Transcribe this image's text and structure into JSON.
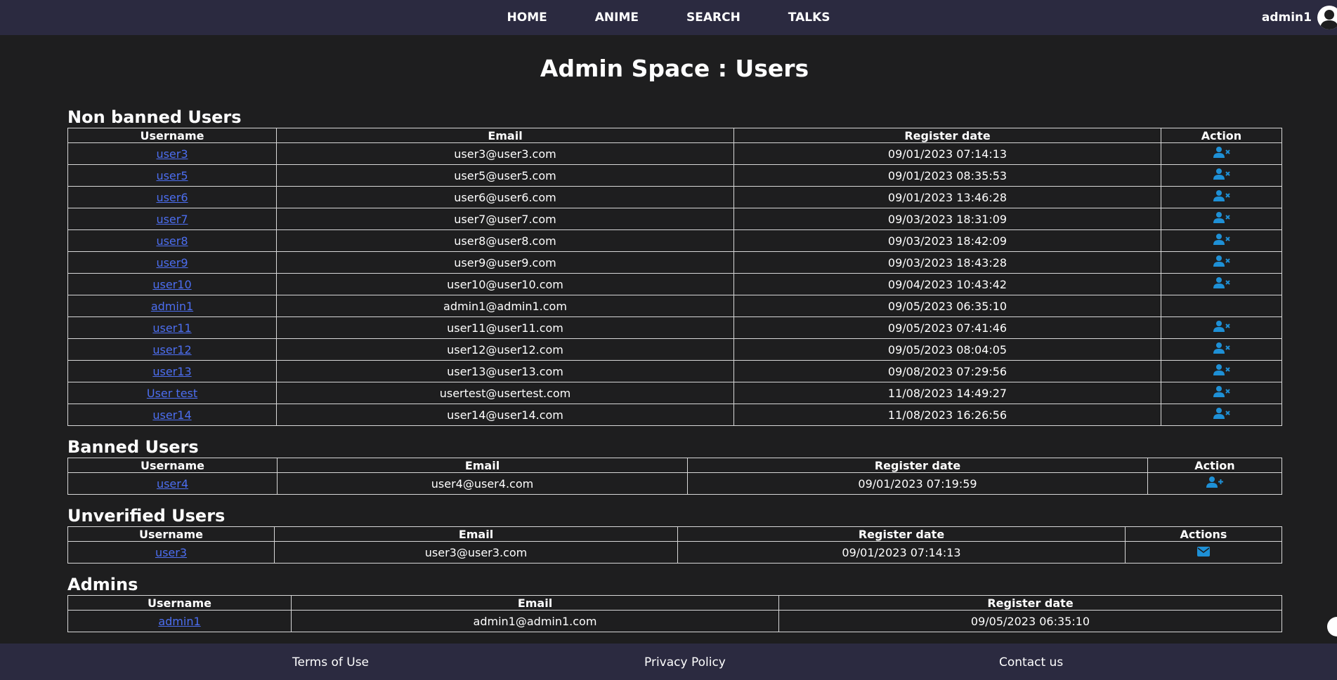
{
  "nav": {
    "links": [
      "HOME",
      "ANIME",
      "SEARCH",
      "TALKS"
    ],
    "username": "admin1",
    "avatar_icon": "user-avatar-icon"
  },
  "page_title": "Admin Space : Users",
  "non_banned": {
    "title": "Non banned Users",
    "headers": [
      "Username",
      "Email",
      "Register date",
      "Action"
    ],
    "rows": [
      {
        "username": "user3",
        "email": "user3@user3.com",
        "date": "09/01/2023 07:14:13",
        "action": "ban-user-icon"
      },
      {
        "username": "user5",
        "email": "user5@user5.com",
        "date": "09/01/2023 08:35:53",
        "action": "ban-user-icon"
      },
      {
        "username": "user6",
        "email": "user6@user6.com",
        "date": "09/01/2023 13:46:28",
        "action": "ban-user-icon"
      },
      {
        "username": "user7",
        "email": "user7@user7.com",
        "date": "09/03/2023 18:31:09",
        "action": "ban-user-icon"
      },
      {
        "username": "user8",
        "email": "user8@user8.com",
        "date": "09/03/2023 18:42:09",
        "action": "ban-user-icon"
      },
      {
        "username": "user9",
        "email": "user9@user9.com",
        "date": "09/03/2023 18:43:28",
        "action": "ban-user-icon"
      },
      {
        "username": "user10",
        "email": "user10@user10.com",
        "date": "09/04/2023 10:43:42",
        "action": "ban-user-icon"
      },
      {
        "username": "admin1",
        "email": "admin1@admin1.com",
        "date": "09/05/2023 06:35:10",
        "action": ""
      },
      {
        "username": "user11",
        "email": "user11@user11.com",
        "date": "09/05/2023 07:41:46",
        "action": "ban-user-icon"
      },
      {
        "username": "user12",
        "email": "user12@user12.com",
        "date": "09/05/2023 08:04:05",
        "action": "ban-user-icon"
      },
      {
        "username": "user13",
        "email": "user13@user13.com",
        "date": "09/08/2023 07:29:56",
        "action": "ban-user-icon"
      },
      {
        "username": "User test",
        "email": "usertest@usertest.com",
        "date": "11/08/2023 14:49:27",
        "action": "ban-user-icon"
      },
      {
        "username": "user14",
        "email": "user14@user14.com",
        "date": "11/08/2023 16:26:56",
        "action": "ban-user-icon"
      }
    ]
  },
  "banned": {
    "title": "Banned Users",
    "headers": [
      "Username",
      "Email",
      "Register date",
      "Action"
    ],
    "rows": [
      {
        "username": "user4",
        "email": "user4@user4.com",
        "date": "09/01/2023 07:19:59",
        "action": "unban-user-icon"
      }
    ]
  },
  "unverified": {
    "title": "Unverified Users",
    "headers": [
      "Username",
      "Email",
      "Register date",
      "Actions"
    ],
    "rows": [
      {
        "username": "user3",
        "email": "user3@user3.com",
        "date": "09/01/2023 07:14:13",
        "action": "envelope-icon"
      }
    ]
  },
  "admins": {
    "title": "Admins",
    "headers": [
      "Username",
      "Email",
      "Register date"
    ],
    "rows": [
      {
        "username": "admin1",
        "email": "admin1@admin1.com",
        "date": "09/05/2023 06:35:10"
      }
    ]
  },
  "footer": {
    "links": [
      "Terms of Use",
      "Privacy Policy",
      "Contact us"
    ]
  },
  "colors": {
    "background": "#1e1e1f",
    "nav_background": "#2b2a40",
    "link": "#4c6ef0",
    "action_icon": "#1e90d6",
    "border": "#d8d8d8"
  }
}
